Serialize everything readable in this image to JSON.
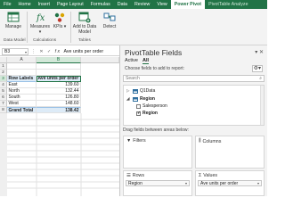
{
  "ribbon_tabs": [
    "File",
    "Home",
    "Insert",
    "Page Layout",
    "Formulas",
    "Data",
    "Review",
    "View",
    "Power Pivot",
    "PivotTable Analyze"
  ],
  "ribbon": {
    "manage_label": "Manage",
    "group1_label": "Data Model",
    "measures_label": "Measures",
    "kpis_label": "KPIs",
    "group2_label": "Calculations",
    "add_to_data_model_label": "Add to Data Model",
    "group3_label": "Tables",
    "detect_label": "Detect"
  },
  "formula_bar": {
    "name_box": "B3",
    "fx": "fx",
    "content": "Ave units per order"
  },
  "grid": {
    "columns": [
      "A",
      "B"
    ],
    "rows": [
      "1",
      "2",
      "3",
      "4",
      "5",
      "6",
      "7",
      "8"
    ],
    "header": [
      "Row Labels",
      "Ave units per order"
    ],
    "data": [
      {
        "label": "East",
        "value": "139.60"
      },
      {
        "label": "North",
        "value": "132.44"
      },
      {
        "label": "South",
        "value": "126.80"
      },
      {
        "label": "West",
        "value": "148.60"
      }
    ],
    "total": {
      "label": "Grand Total",
      "value": "138.42"
    }
  },
  "pivot_pane": {
    "title": "PivotTable Fields",
    "tabs": [
      "Active",
      "All"
    ],
    "choose_label": "Choose fields to add to report:",
    "search_placeholder": "Search",
    "fields": [
      {
        "name": "Q1Data",
        "type": "table",
        "checked": false,
        "bold": false
      },
      {
        "name": "Region",
        "type": "table",
        "checked": false,
        "bold": true
      },
      {
        "name": "Salesperson",
        "type": "field",
        "checked": false,
        "bold": false
      },
      {
        "name": "Region",
        "type": "field",
        "checked": true,
        "bold": false
      }
    ],
    "drag_label": "Drag fields between areas below:",
    "areas": {
      "filters": "Filters",
      "columns": "Columns",
      "rows": "Rows",
      "values": "Values"
    },
    "rows_chip": "Region",
    "values_chip": "Ave units per order"
  },
  "colors": {
    "excel_green": "#217346",
    "pivot_header_blue": "#ddebf7"
  }
}
